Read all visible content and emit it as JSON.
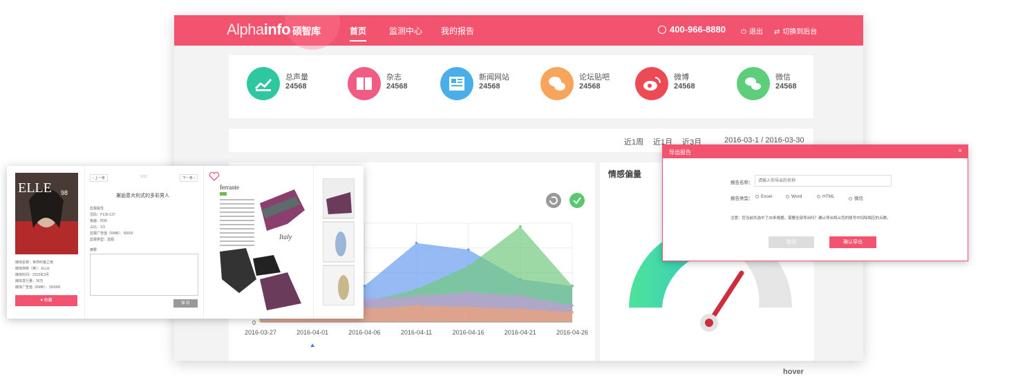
{
  "header": {
    "logo_alpha": "Alpha",
    "logo_info": "info",
    "logo_cn": "硕智库",
    "nav": [
      {
        "label": "首页",
        "active": true
      },
      {
        "label": "监测中心",
        "active": false
      },
      {
        "label": "我的报告",
        "active": false
      }
    ],
    "phone": "400-966-8880",
    "logout": "退出",
    "switch": "切换到后台"
  },
  "stats": [
    {
      "label": "总声量",
      "value": "24568",
      "color": "#2ec7a0",
      "icon": "chart-up-icon"
    },
    {
      "label": "杂志",
      "value": "24568",
      "color": "#f25b82",
      "icon": "book-icon"
    },
    {
      "label": "新闻网站",
      "value": "24568",
      "color": "#4aaee8",
      "icon": "news-icon"
    },
    {
      "label": "论坛贴吧",
      "value": "24568",
      "color": "#f6a55b",
      "icon": "chat-bubble-icon"
    },
    {
      "label": "微博",
      "value": "24568",
      "color": "#ec4b55",
      "icon": "weibo-icon"
    },
    {
      "label": "微信",
      "value": "24568",
      "color": "#5fce7b",
      "icon": "wechat-icon"
    }
  ],
  "filter": {
    "week": "近1周",
    "month": "近1月",
    "quarter": "近3月",
    "range": "2016-03-1 / 2016-03-30"
  },
  "emotion": {
    "title": "情感偏量"
  },
  "chart_data": {
    "type": "area",
    "categories": [
      "2016-03-27",
      "2016-04-01",
      "2016-04-06",
      "2016-04-11",
      "2016-04-16",
      "2016-04-21",
      "2016-04-26"
    ],
    "y_zero_label": "0",
    "series": [
      {
        "color": "#6a9ef0",
        "values": [
          5,
          14,
          22,
          48,
          44,
          26,
          22
        ]
      },
      {
        "color": "#72c97f",
        "values": [
          2,
          6,
          12,
          20,
          34,
          58,
          22
        ]
      },
      {
        "color": "#c59ad8",
        "values": [
          3,
          10,
          14,
          16,
          18,
          16,
          10
        ]
      },
      {
        "color": "#f2a172",
        "values": [
          1,
          4,
          8,
          10,
          9,
          8,
          6
        ]
      }
    ]
  },
  "popup": {
    "title": "导出报告",
    "close": "×",
    "name_label": "报告名称：",
    "name_placeholder": "请输入你导出的名称",
    "type_label": "报告类型：",
    "types": [
      "Excel",
      "Word",
      "HTML",
      "微信"
    ],
    "note": "注意：您当前共选中了35条报据，需要全部导出吗？确认导出将从您的账号中扣除相应的点数。",
    "cancel": "取消",
    "confirm": "确认导出"
  },
  "magazine": {
    "prev": "‹ 上一条",
    "page": "1/12",
    "next": "下一条 ›",
    "title": "邂逅意大利式的多彩男人",
    "attr_header": "剪报属性",
    "attrs": [
      "页码：P135-137",
      "板面：时尚",
      "占比：1/3",
      "剪报广告值（RMB）：50000",
      "剪报类型：选题"
    ],
    "summary_label": "摘要",
    "save": "保 存",
    "favorite": "收藏",
    "meta": [
      "媒体名称：世界时装之苑",
      "媒体简称（英）：ELLE",
      "媒体时间：2016年3月",
      "媒体发行量：30万",
      "媒体广告值（RMB）：150000"
    ],
    "page_brand": "ferrante",
    "page_italy": "Italy"
  },
  "hover_label": "hover"
}
